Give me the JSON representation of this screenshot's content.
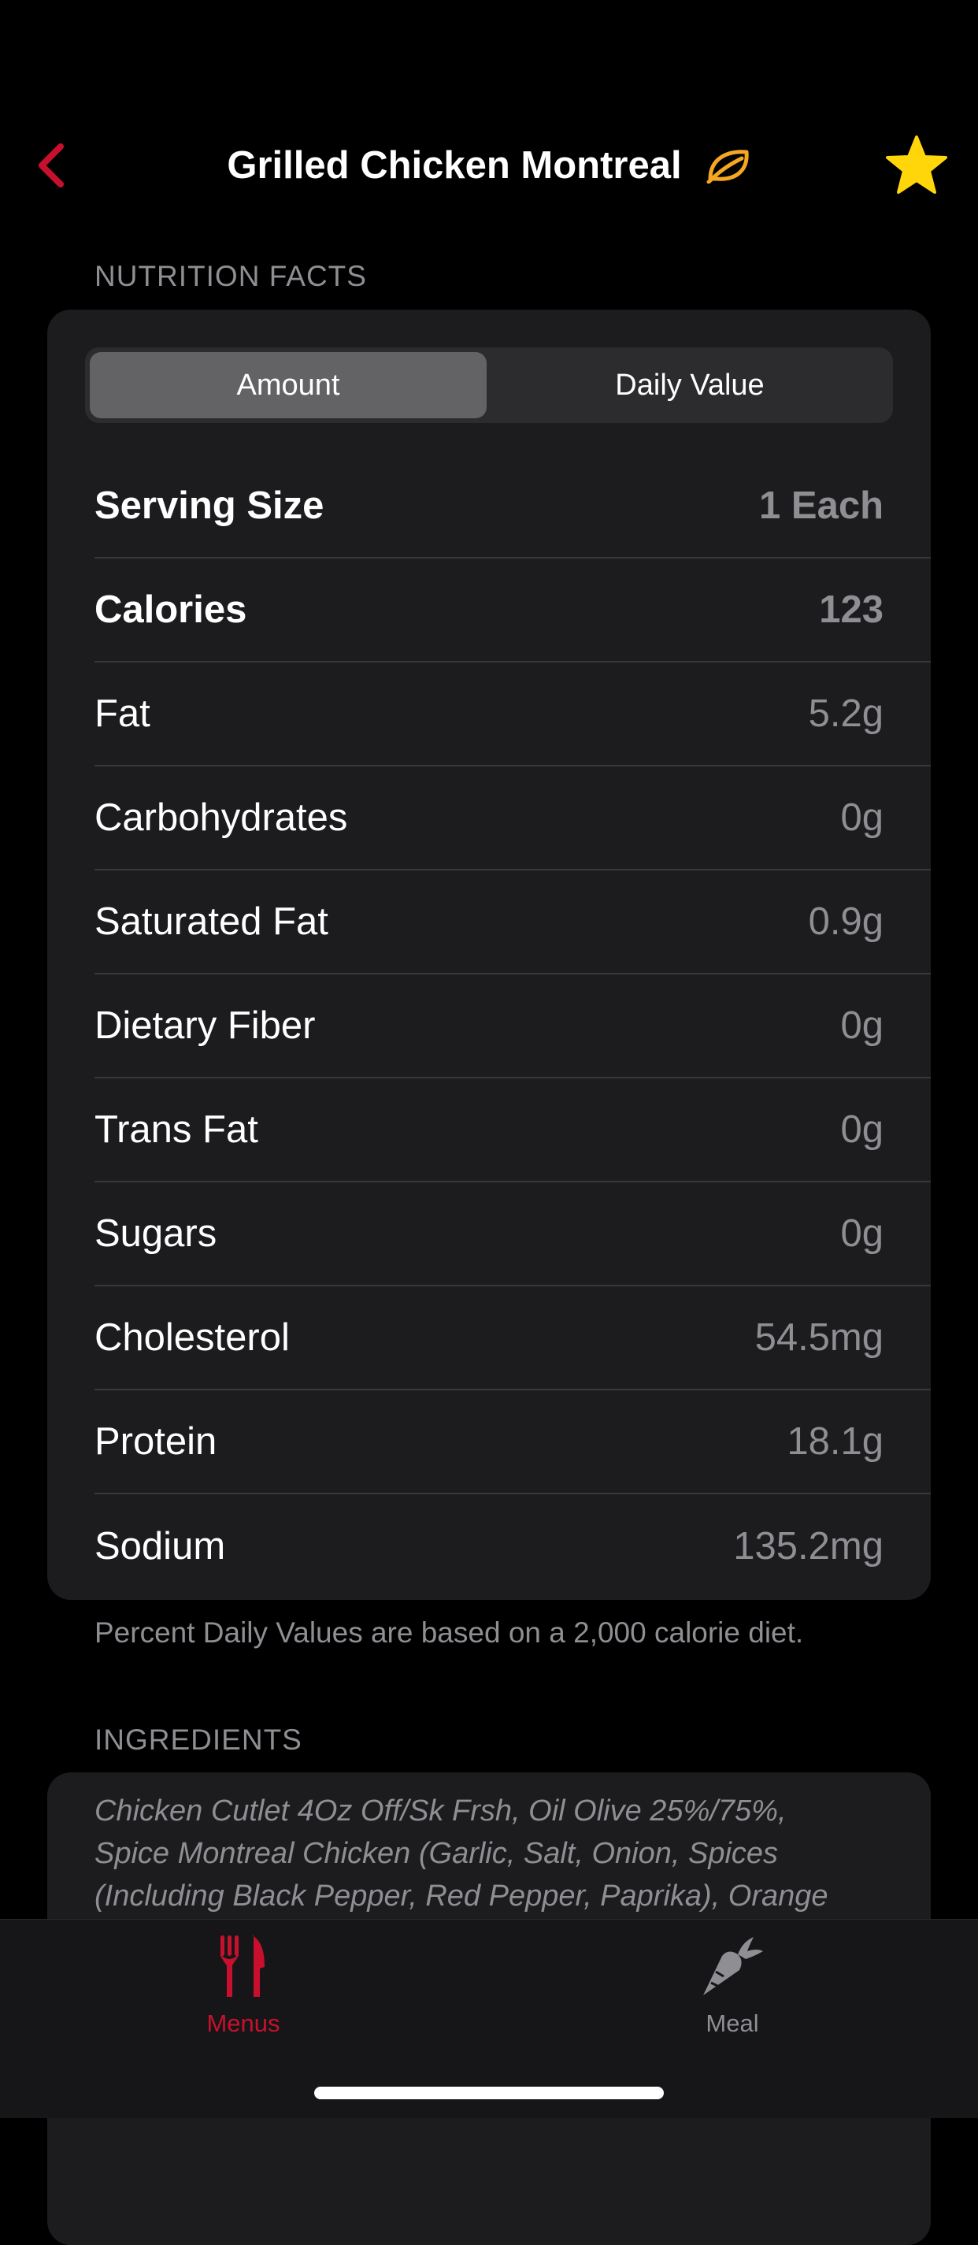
{
  "nav": {
    "title": "Grilled Chicken Montreal",
    "back_icon": "chevron-left-icon",
    "diet_icon": "leaf-icon",
    "favorite_icon": "star-icon"
  },
  "colors": {
    "accent": "#c8102e",
    "leaf": "#f5a623",
    "star": "#ffd60a"
  },
  "nutrition": {
    "header": "NUTRITION FACTS",
    "segments": [
      "Amount",
      "Daily Value"
    ],
    "rows": [
      {
        "label": "Serving Size",
        "value": "1 Each"
      },
      {
        "label": "Calories",
        "value": "123"
      },
      {
        "label": "Fat",
        "value": "5.2g"
      },
      {
        "label": "Carbohydrates",
        "value": "0g"
      },
      {
        "label": "Saturated Fat",
        "value": "0.9g"
      },
      {
        "label": "Dietary Fiber",
        "value": "0g"
      },
      {
        "label": "Trans Fat",
        "value": "0g"
      },
      {
        "label": "Sugars",
        "value": "0g"
      },
      {
        "label": "Cholesterol",
        "value": "54.5mg"
      },
      {
        "label": "Protein",
        "value": "18.1g"
      },
      {
        "label": "Sodium",
        "value": "135.2mg"
      }
    ],
    "footnote": "Percent Daily Values are based on a 2,000 calorie diet."
  },
  "ingredients": {
    "header": "INGREDIENTS",
    "lines": [
      "Chicken Cutlet 4Oz Off/Sk Frsh, Oil Olive 25%/75%,",
      "Spice Montreal Chicken (Garlic, Salt, Onion, Spices",
      "(Including Black Pepper, Red Pepper, Paprika), Orange"
    ]
  },
  "tabbar": {
    "tabs": [
      {
        "label": "Menus",
        "icon": "fork-knife-icon",
        "active": true
      },
      {
        "label": "Meal",
        "icon": "carrot-icon",
        "active": false
      }
    ]
  }
}
